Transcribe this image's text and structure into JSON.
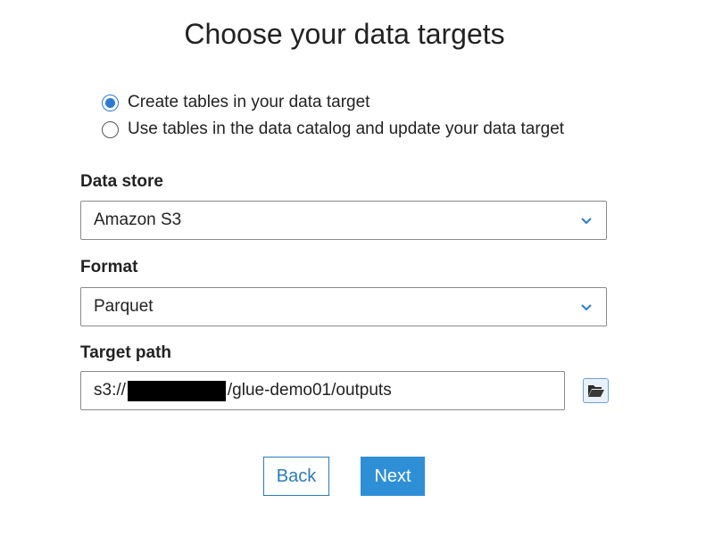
{
  "page": {
    "title": "Choose your data targets"
  },
  "radios": [
    {
      "label": "Create tables in your data target",
      "checked": true
    },
    {
      "label": "Use tables in the data catalog and update your data target",
      "checked": false
    }
  ],
  "data_store": {
    "label": "Data store",
    "value": "Amazon S3",
    "icon": "chevron-down-icon"
  },
  "format": {
    "label": "Format",
    "value": "Parquet",
    "icon": "chevron-down-icon"
  },
  "target_path": {
    "label": "Target path",
    "prefix": "s3://",
    "suffix": "/glue-demo01/outputs",
    "browse_icon": "folder-open-icon"
  },
  "buttons": {
    "back": "Back",
    "next": "Next"
  },
  "colors": {
    "accent": "#2e8fd6",
    "radio": "#2b7bd3"
  }
}
